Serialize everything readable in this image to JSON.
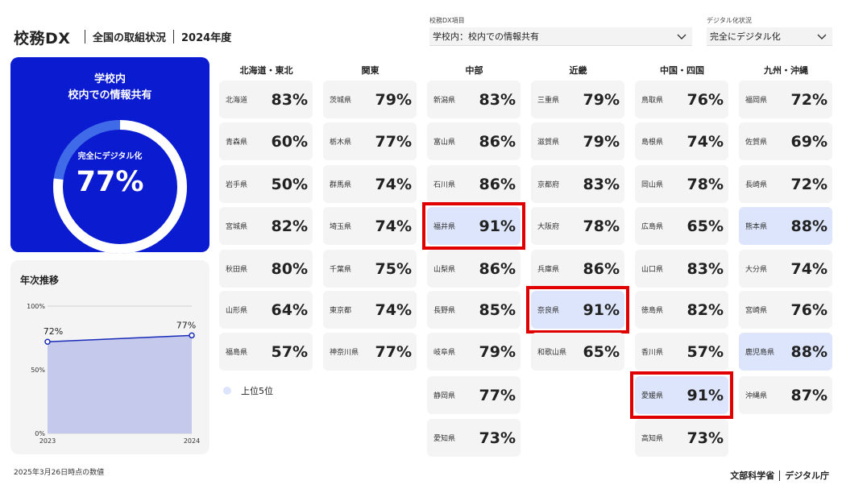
{
  "header": {
    "title": "校務DX",
    "subtitle": "全国の取組状況",
    "year": "2024年度"
  },
  "filters": [
    {
      "label": "校務DX項目",
      "value": "学校内：校内での情報共有"
    },
    {
      "label": "デジタル化状況",
      "value": "完全にデジタル化"
    }
  ],
  "kpi": {
    "title_line1": "学校内",
    "title_line2": "校内での情報共有",
    "label": "完全にデジタル化",
    "value": "77%",
    "ratio": 0.77,
    "color": "#0a1bd0",
    "ring_color": "#ffffff",
    "ring_remainder_color": "#3f6ae8"
  },
  "trend": {
    "title": "年次推移",
    "chart_data": {
      "type": "area",
      "x": [
        "2023",
        "2024"
      ],
      "values": [
        72,
        77
      ],
      "data_labels": [
        "72%",
        "77%"
      ],
      "ylim": [
        0,
        100
      ],
      "yticks": [
        "0%",
        "50%",
        "100%"
      ],
      "color": "#1a2bb8",
      "fill": "#c5c9ec"
    }
  },
  "regions": [
    {
      "name": "北海道・東北",
      "prefectures": [
        {
          "name": "北海道",
          "value": "83%"
        },
        {
          "name": "青森県",
          "value": "60%"
        },
        {
          "name": "岩手県",
          "value": "50%"
        },
        {
          "name": "宮城県",
          "value": "82%"
        },
        {
          "name": "秋田県",
          "value": "80%"
        },
        {
          "name": "山形県",
          "value": "64%"
        },
        {
          "name": "福島県",
          "value": "57%"
        }
      ]
    },
    {
      "name": "関東",
      "prefectures": [
        {
          "name": "茨城県",
          "value": "79%"
        },
        {
          "name": "栃木県",
          "value": "77%"
        },
        {
          "name": "群馬県",
          "value": "74%"
        },
        {
          "name": "埼玉県",
          "value": "74%"
        },
        {
          "name": "千葉県",
          "value": "75%"
        },
        {
          "name": "東京都",
          "value": "74%"
        },
        {
          "name": "神奈川県",
          "value": "77%"
        }
      ]
    },
    {
      "name": "中部",
      "prefectures": [
        {
          "name": "新潟県",
          "value": "83%"
        },
        {
          "name": "富山県",
          "value": "86%"
        },
        {
          "name": "石川県",
          "value": "86%"
        },
        {
          "name": "福井県",
          "value": "91%",
          "top5": true,
          "highlight": true
        },
        {
          "name": "山梨県",
          "value": "86%"
        },
        {
          "name": "長野県",
          "value": "85%"
        },
        {
          "name": "岐阜県",
          "value": "79%"
        },
        {
          "name": "静岡県",
          "value": "77%"
        },
        {
          "name": "愛知県",
          "value": "73%"
        }
      ]
    },
    {
      "name": "近畿",
      "prefectures": [
        {
          "name": "三重県",
          "value": "79%"
        },
        {
          "name": "滋賀県",
          "value": "79%"
        },
        {
          "name": "京都府",
          "value": "83%"
        },
        {
          "name": "大阪府",
          "value": "78%"
        },
        {
          "name": "兵庫県",
          "value": "86%"
        },
        {
          "name": "奈良県",
          "value": "91%",
          "top5": true,
          "highlight": true
        },
        {
          "name": "和歌山県",
          "value": "65%"
        }
      ]
    },
    {
      "name": "中国・四国",
      "prefectures": [
        {
          "name": "鳥取県",
          "value": "76%"
        },
        {
          "name": "島根県",
          "value": "74%"
        },
        {
          "name": "岡山県",
          "value": "78%"
        },
        {
          "name": "広島県",
          "value": "65%"
        },
        {
          "name": "山口県",
          "value": "83%"
        },
        {
          "name": "徳島県",
          "value": "82%"
        },
        {
          "name": "香川県",
          "value": "57%"
        },
        {
          "name": "愛媛県",
          "value": "91%",
          "top5": true,
          "highlight": true
        },
        {
          "name": "高知県",
          "value": "73%"
        }
      ]
    },
    {
      "name": "九州・沖縄",
      "prefectures": [
        {
          "name": "福岡県",
          "value": "72%"
        },
        {
          "name": "佐賀県",
          "value": "69%"
        },
        {
          "name": "長崎県",
          "value": "72%"
        },
        {
          "name": "熊本県",
          "value": "88%",
          "top5": true
        },
        {
          "name": "大分県",
          "value": "74%"
        },
        {
          "name": "宮崎県",
          "value": "76%"
        },
        {
          "name": "鹿児島県",
          "value": "88%",
          "top5": true
        },
        {
          "name": "沖縄県",
          "value": "87%"
        }
      ]
    }
  ],
  "legend": {
    "label": "上位5位",
    "color": "#dce5fb"
  },
  "footnote": "2025年3月26日時点の数値",
  "source": {
    "left": "文部科学省",
    "right": "デジタル庁"
  },
  "colors": {
    "highlight_border": "#e00000",
    "card_bg": "#f4f4f4"
  }
}
